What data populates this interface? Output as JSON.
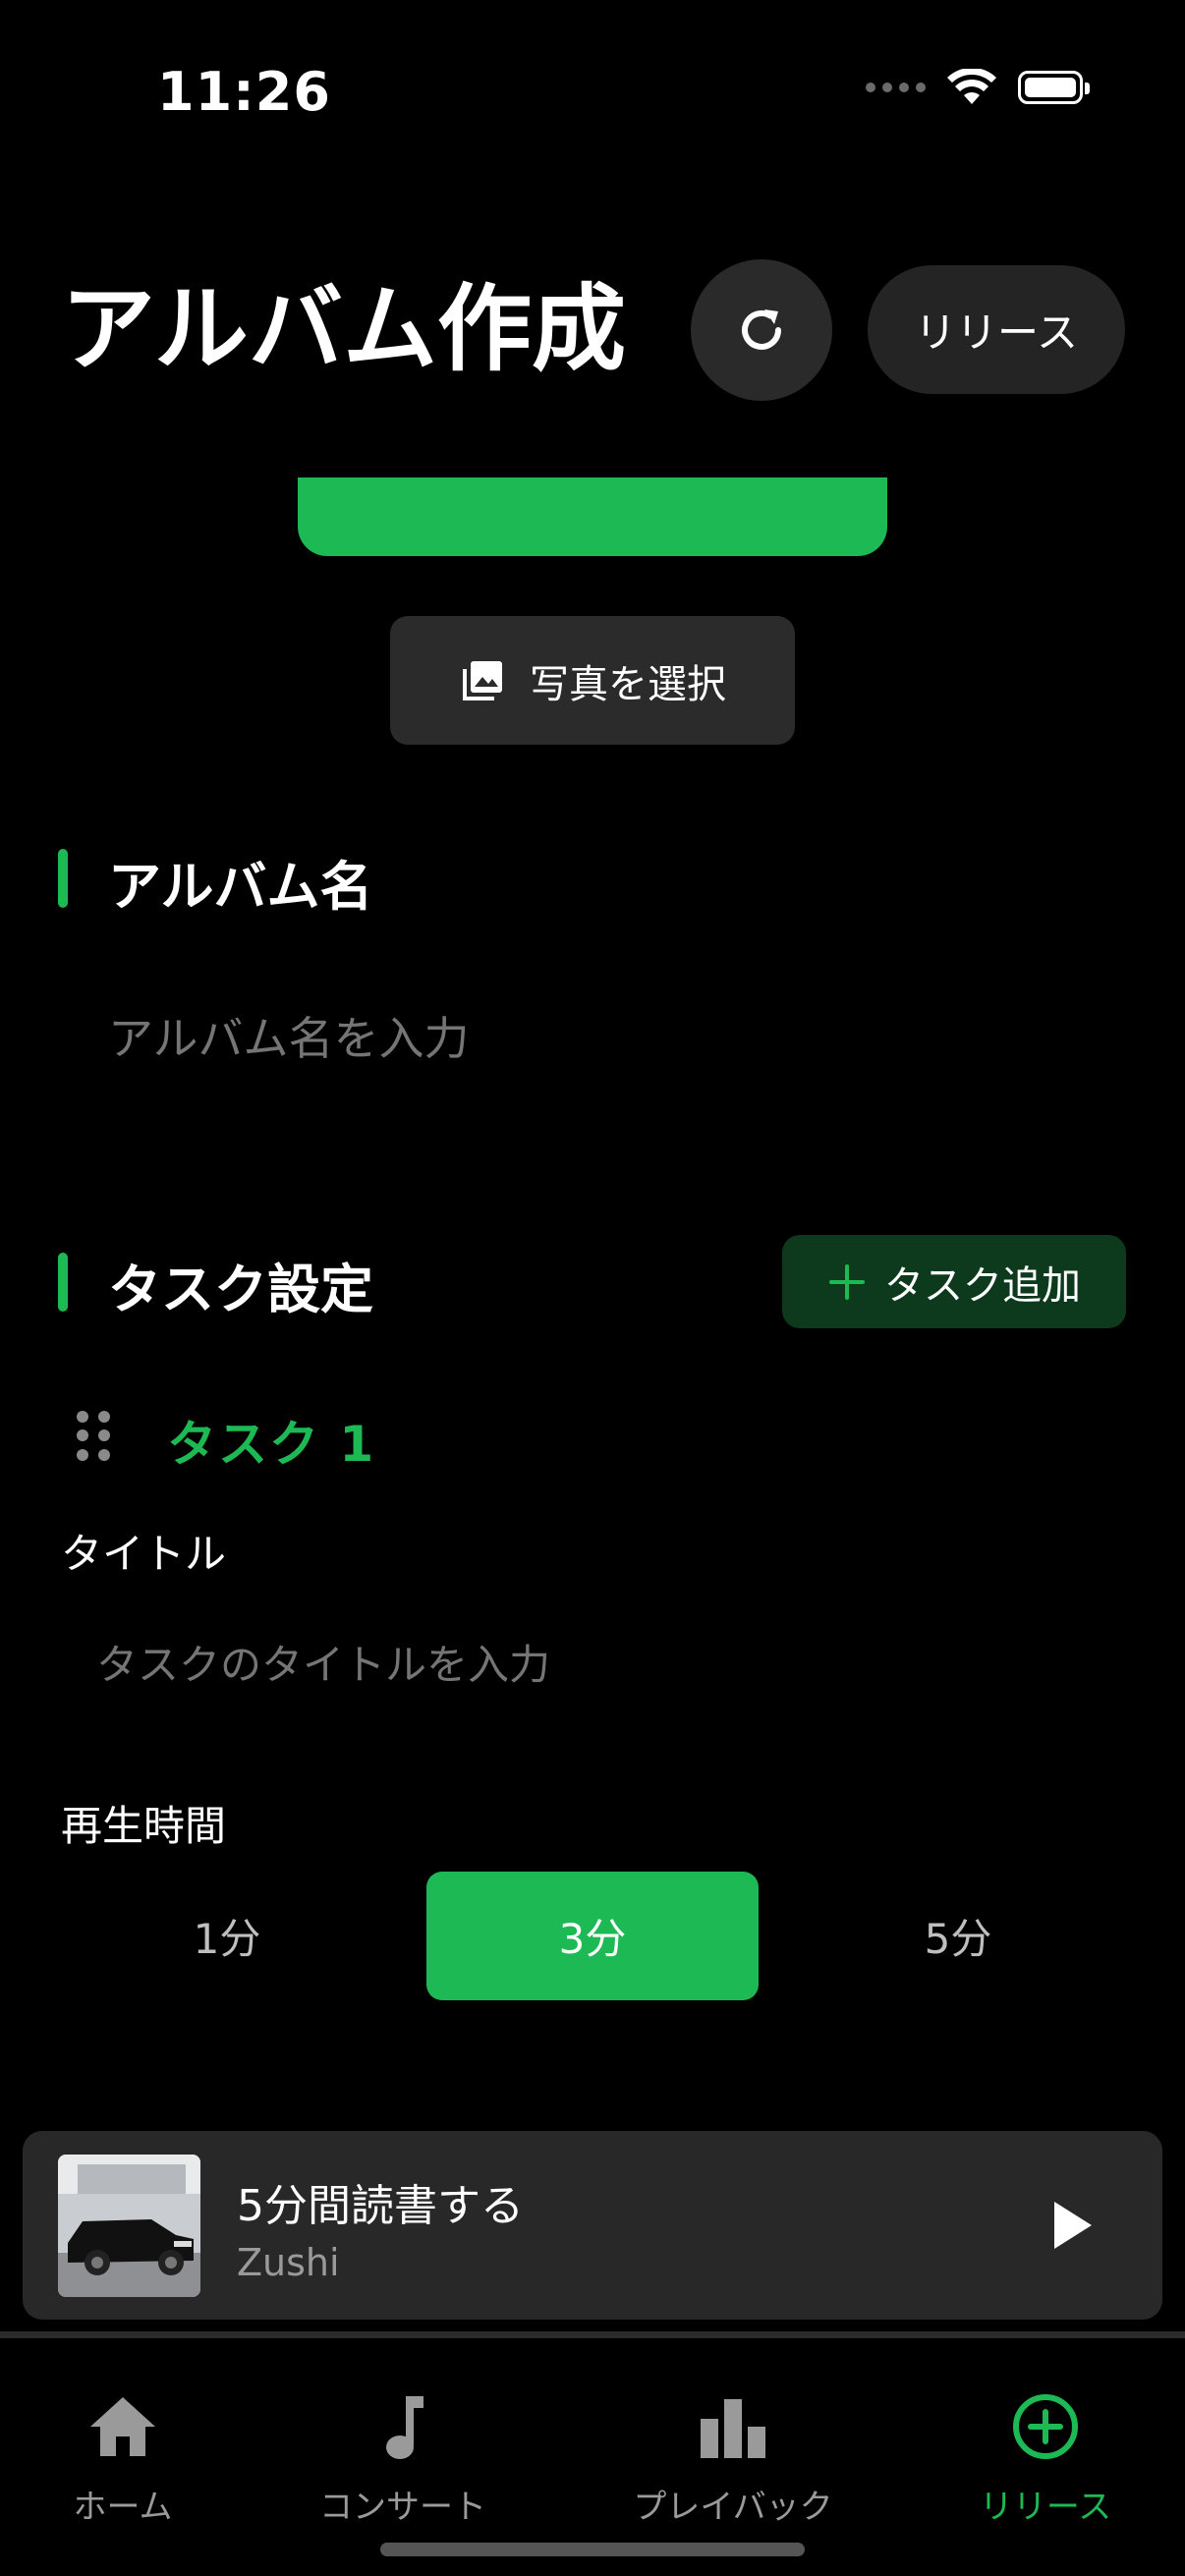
{
  "status_bar": {
    "time": "11:26"
  },
  "header": {
    "title": "アルバム作成",
    "release_label": "リリース"
  },
  "photo_button": {
    "label": "写真を選択"
  },
  "album_section": {
    "title": "アルバム名",
    "input_placeholder": "アルバム名を入力"
  },
  "task_section": {
    "title": "タスク設定",
    "add_task_label": "タスク追加",
    "task": {
      "label": "タスク 1",
      "title_field_label": "タイトル",
      "title_placeholder": "タスクのタイトルを入力",
      "duration_label": "再生時間",
      "duration_options": [
        "1分",
        "3分",
        "5分"
      ],
      "selected_duration": "3分"
    }
  },
  "now_playing": {
    "title": "5分間読書する",
    "artist": "Zushi"
  },
  "tab_bar": {
    "items": [
      {
        "label": "ホーム",
        "icon": "home-icon"
      },
      {
        "label": "コンサート",
        "icon": "music-note-icon"
      },
      {
        "label": "プレイバック",
        "icon": "bar-chart-icon"
      },
      {
        "label": "リリース",
        "icon": "plus-circle-icon",
        "active": true
      }
    ]
  },
  "colors": {
    "accent": "#1db954",
    "background": "#000000",
    "card": "#282828"
  }
}
